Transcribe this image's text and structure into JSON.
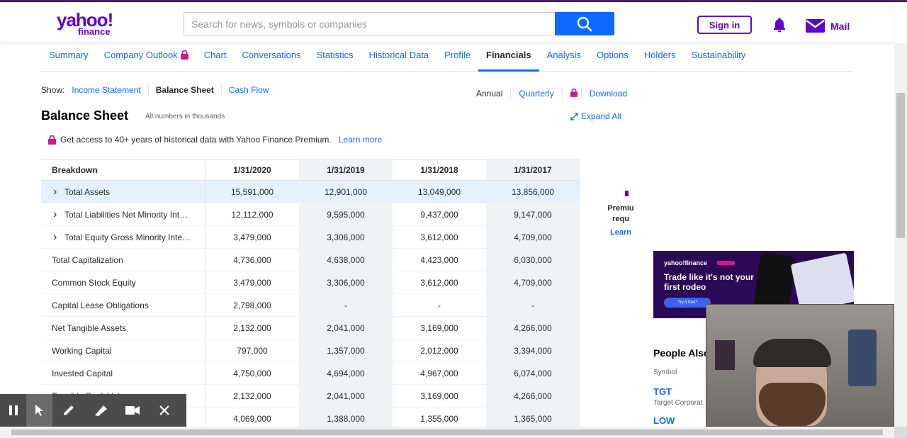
{
  "brand": {
    "line1": "yahoo!",
    "line2": "finance",
    "color": "#6001d2"
  },
  "search": {
    "placeholder": "Search for news, symbols or companies",
    "icon": "search-icon"
  },
  "header": {
    "signin_label": "Sign in",
    "bell_icon": "bell-icon",
    "mail_label": "Mail"
  },
  "nav": {
    "tabs": [
      {
        "label": "Summary"
      },
      {
        "label": "Company Outlook",
        "locked": true
      },
      {
        "label": "Chart"
      },
      {
        "label": "Conversations"
      },
      {
        "label": "Statistics"
      },
      {
        "label": "Historical Data"
      },
      {
        "label": "Profile"
      },
      {
        "label": "Financials",
        "active": true
      },
      {
        "label": "Analysis"
      },
      {
        "label": "Options"
      },
      {
        "label": "Holders"
      },
      {
        "label": "Sustainability"
      }
    ]
  },
  "show": {
    "label": "Show:",
    "options": [
      "Income Statement",
      "Balance Sheet",
      "Cash Flow"
    ],
    "active": "Balance Sheet"
  },
  "period": {
    "annual": "Annual",
    "quarterly": "Quarterly",
    "download": "Download"
  },
  "page": {
    "title": "Balance Sheet",
    "subnote": "All numbers in thousands",
    "expand_all": "Expand All",
    "premium_note": "Get access to 40+ years of historical data with Yahoo Finance Premium.",
    "learn_more": "Learn more"
  },
  "table": {
    "headers": [
      "Breakdown",
      "1/31/2020",
      "1/31/2019",
      "1/31/2018",
      "1/31/2017"
    ],
    "rows": [
      {
        "name": "Total Assets",
        "expandable": true,
        "highlight": true,
        "values": [
          "15,591,000",
          "12,901,000",
          "13,049,000",
          "13,856,000"
        ]
      },
      {
        "name": "Total Liabilities Net Minority Int…",
        "expandable": true,
        "values": [
          "12,112,000",
          "9,595,000",
          "9,437,000",
          "9,147,000"
        ]
      },
      {
        "name": "Total Equity Gross Minority Inte…",
        "expandable": true,
        "values": [
          "3,479,000",
          "3,306,000",
          "3,612,000",
          "4,709,000"
        ]
      },
      {
        "name": "Total Capitalization",
        "values": [
          "4,736,000",
          "4,638,000",
          "4,423,000",
          "6,030,000"
        ]
      },
      {
        "name": "Common Stock Equity",
        "values": [
          "3,479,000",
          "3,306,000",
          "3,612,000",
          "4,709,000"
        ]
      },
      {
        "name": "Capital Lease Obligations",
        "values": [
          "2,798,000",
          "-",
          "-",
          "-"
        ]
      },
      {
        "name": "Net Tangible Assets",
        "values": [
          "2,132,000",
          "2,041,000",
          "3,169,000",
          "4,266,000"
        ]
      },
      {
        "name": "Working Capital",
        "values": [
          "797,000",
          "1,357,000",
          "2,012,000",
          "3,394,000"
        ]
      },
      {
        "name": "Invested Capital",
        "values": [
          "4,750,000",
          "4,694,000",
          "4,967,000",
          "6,074,000"
        ]
      },
      {
        "name": "Tangible Book Value",
        "values": [
          "2,132,000",
          "2,041,000",
          "3,169,000",
          "4,266,000"
        ]
      },
      {
        "name": "",
        "values": [
          "4,069,000",
          "1,388,000",
          "1,355,000",
          "1,365,000"
        ]
      }
    ]
  },
  "premium_side": {
    "line1": "Premiu",
    "line2": "requ",
    "line3": "Learn"
  },
  "ad": {
    "brand": "yahoo!finance",
    "title": "Trade like it's not your first rodeo",
    "cta": "Try it free*"
  },
  "people_also": {
    "title": "People Also",
    "symbol_header": "Symbol",
    "items": [
      {
        "symbol": "TGT",
        "name": "Target Corporat"
      },
      {
        "symbol": "LOW"
      }
    ]
  },
  "recorder": {
    "icons": [
      "pause-icon",
      "cursor-icon",
      "pen-icon",
      "highlighter-icon",
      "camera-icon",
      "close-icon"
    ]
  }
}
